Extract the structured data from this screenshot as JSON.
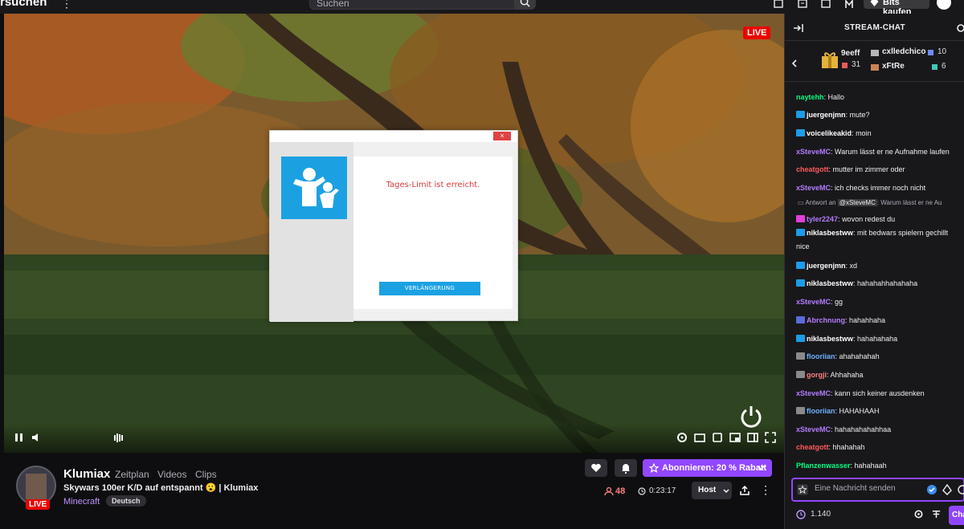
{
  "topbar": {
    "brand": "rsuchen",
    "search_placeholder": "Suchen",
    "bits_label": "Bits kaufen"
  },
  "player": {
    "live_badge": "LIVE"
  },
  "dialog": {
    "close_label": "×",
    "message": "Tages-Limit ist erreicht.",
    "button_label": "VERLÄNGERUNG"
  },
  "channel": {
    "name": "Klumiax",
    "live_badge": "LIVE",
    "nav": [
      "Zeitplan",
      "Videos",
      "Clips"
    ],
    "stream_title": "Skywars 100er K/D auf entspannt 😮 | Klumiax",
    "game": "Minecraft",
    "language_tag": "Deutsch",
    "subscribe_label": "Abonnieren: 20 % Rabatt",
    "viewers": "48",
    "uptime": "0:23:17",
    "host_label": "Host"
  },
  "chat": {
    "header_title": "STREAM-CHAT",
    "gifts": [
      {
        "user": "9eeff",
        "count": "31"
      },
      {
        "user": "cxlledchico",
        "count": "10"
      },
      {
        "user": "xFtRe",
        "count": "6"
      }
    ],
    "reply": {
      "prefix": "Antwort an",
      "mention": "@xSteveMC",
      "text": ": Warum lässt er ne Au"
    },
    "messages": [
      {
        "user": "naytehh",
        "color": "#00ff7f",
        "text": "Hallo",
        "badge": "none"
      },
      {
        "user": "juergenjmn",
        "color": "#ffffff",
        "text": "mute?",
        "badge": "crown"
      },
      {
        "user": "voicelikeakid",
        "color": "#ffffff",
        "text": "moin",
        "badge": "crown"
      },
      {
        "user": "xSteveMC",
        "color": "#b57cff",
        "text": "Warum lässt er ne Aufnahme laufen",
        "badge": "none"
      },
      {
        "user": "cheatgott",
        "color": "#ff5a5a",
        "text": "mutter im zimmer oder",
        "badge": "none"
      },
      {
        "user": "xSteveMC",
        "color": "#b57cff",
        "text": "ich checks immer noch nicht",
        "badge": "none"
      },
      {
        "user": "tyler2247",
        "color": "#b57cff",
        "text": "wovon redest du",
        "badge": "heart"
      },
      {
        "user": "niklasbestww",
        "color": "#ffffff",
        "text": "mit bedwars spielern gechillt",
        "badge": "crown"
      },
      {
        "user": "",
        "color": "#ffffff",
        "text": "nice",
        "badge": "none"
      },
      {
        "user": "juergenjmn",
        "color": "#ffffff",
        "text": "xd",
        "badge": "crown"
      },
      {
        "user": "niklasbestww",
        "color": "#ffffff",
        "text": "hahahahhahahaha",
        "badge": "crown"
      },
      {
        "user": "xSteveMC",
        "color": "#b57cff",
        "text": "gg",
        "badge": "none"
      },
      {
        "user": "Abrchnung",
        "color": "#b57cff",
        "text": "hahahhaha",
        "badge": "tv"
      },
      {
        "user": "niklasbestww",
        "color": "#ffffff",
        "text": "hahahahaha",
        "badge": "crown"
      },
      {
        "user": "flooriian",
        "color": "#6fb0ff",
        "text": "ahahahahah",
        "badge": "hand"
      },
      {
        "user": "gorgji",
        "color": "#ff7f7f",
        "text": "Ahhahaha",
        "badge": "hand"
      },
      {
        "user": "xSteveMC",
        "color": "#b57cff",
        "text": "kann sich keiner ausdenken",
        "badge": "none"
      },
      {
        "user": "flooriian",
        "color": "#6fb0ff",
        "text": "HAHAHAAH",
        "badge": "hand"
      },
      {
        "user": "xSteveMC",
        "color": "#b57cff",
        "text": "hahahahahahhaa",
        "badge": "none"
      },
      {
        "user": "cheatgott",
        "color": "#ff5a5a",
        "text": "hhahahah",
        "badge": "none"
      },
      {
        "user": "Pflanzenwasser",
        "color": "#00ff7f",
        "text": "hahahaah",
        "badge": "none"
      }
    ],
    "input_placeholder": "Eine Nachricht senden",
    "points": "1.140",
    "send_label": "Cha"
  },
  "colors": {
    "accent": "#9147ff",
    "live": "#eb0400",
    "dialog_blue": "#1ba1e2",
    "dialog_error": "#d9383a"
  }
}
